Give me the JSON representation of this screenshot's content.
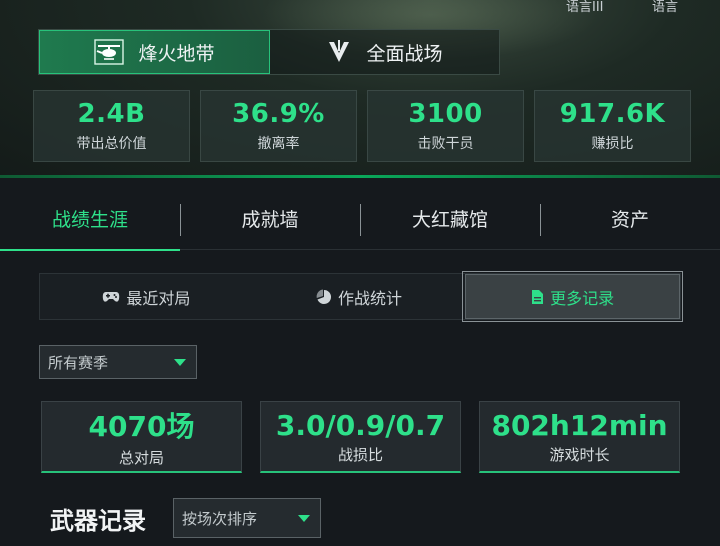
{
  "hero": {
    "top_left_cut": "语言III",
    "top_right_cut": "语言",
    "mode_tabs": [
      {
        "label": "烽火地带",
        "icon": "helicopter-icon",
        "active": true
      },
      {
        "label": "全面战场",
        "icon": "delta-emblem-icon",
        "active": false
      }
    ],
    "stats": [
      {
        "value": "2.4B",
        "label": "带出总价值"
      },
      {
        "value": "36.9%",
        "label": "撤离率"
      },
      {
        "value": "3100",
        "label": "击败干员"
      },
      {
        "value": "917.6K",
        "label": "赚损比"
      }
    ]
  },
  "main_tabs": [
    {
      "label": "战绩生涯",
      "active": true
    },
    {
      "label": "成就墙",
      "active": false
    },
    {
      "label": "大红藏馆",
      "active": false
    },
    {
      "label": "资产",
      "active": false
    }
  ],
  "sub_tabs": [
    {
      "label": "最近对局",
      "icon": "gamepad-icon",
      "active": false
    },
    {
      "label": "作战统计",
      "icon": "pie-chart-icon",
      "active": false
    },
    {
      "label": "更多记录",
      "icon": "document-icon",
      "active": true
    }
  ],
  "season_filter": {
    "value": "所有赛季"
  },
  "summary": [
    {
      "value": "4070场",
      "label": "总对局"
    },
    {
      "value": "3.0/0.9/0.7",
      "label": "战损比"
    },
    {
      "value": "802h12min",
      "label": "游戏时长"
    }
  ],
  "weapon_section": {
    "title": "武器记录",
    "sort_value": "按场次排序"
  },
  "colors": {
    "accent": "#2ee08a",
    "active_tab_bg": "#1f7a4e",
    "background": "#15191d"
  }
}
